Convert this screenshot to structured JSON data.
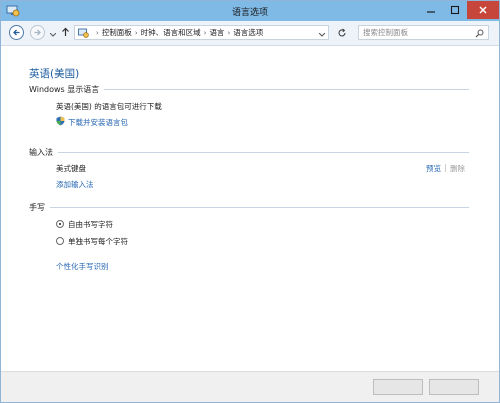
{
  "window": {
    "title": "语言选项"
  },
  "address_bar": {
    "breadcrumbs": [
      "控制面板",
      "时钟、语言和区域",
      "语言",
      "语言选项"
    ],
    "search_placeholder": "搜索控制面板"
  },
  "language": {
    "name": "英语(美国)"
  },
  "display_language": {
    "heading": "Windows 显示语言",
    "status": "英语(美国) 的语言包可进行下载",
    "download_link": "下载并安装语言包"
  },
  "input_method": {
    "heading": "输入法",
    "keyboard": "美式键盘",
    "preview_link": "预览",
    "separator": "|",
    "delete_label": "删除",
    "add_link": "添加输入法"
  },
  "handwriting": {
    "heading": "手写",
    "options": [
      {
        "label": "自由书写字符",
        "checked": true
      },
      {
        "label": "单独书写每个字符",
        "checked": false
      }
    ],
    "personalize_link": "个性化手写识别"
  },
  "colors": {
    "titlebar": "#7fb9e6",
    "link": "#2466b3",
    "heading_blue": "#1a5a9c",
    "close_button": "#c7463c"
  },
  "icons": {
    "app": "control-panel-icon",
    "back": "back-arrow-icon",
    "forward": "forward-arrow-icon",
    "up": "up-arrow-icon",
    "refresh": "refresh-icon",
    "search": "search-icon",
    "shield": "shield-icon"
  }
}
